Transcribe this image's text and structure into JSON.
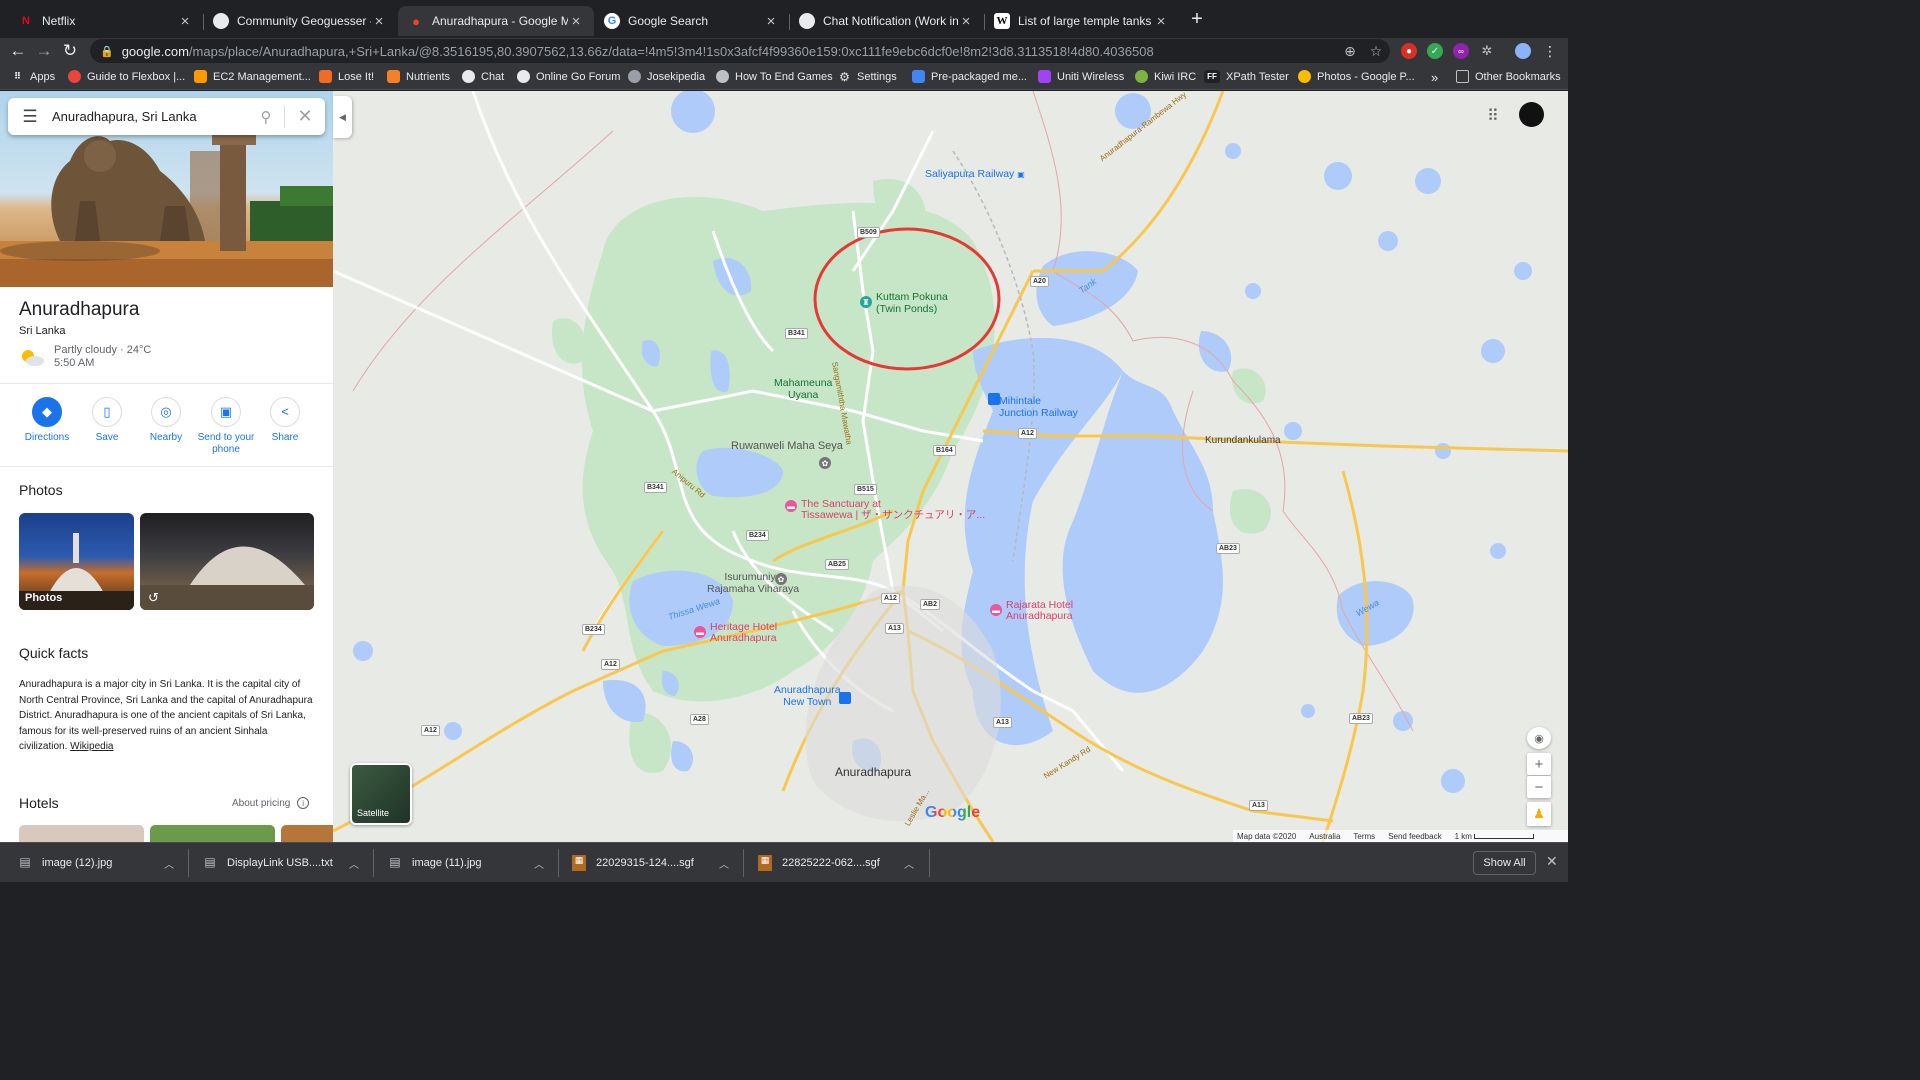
{
  "tabs": [
    {
      "title": "Netflix",
      "favicon": "netflix-icon",
      "active": false
    },
    {
      "title": "Community Geoguesser - Gen",
      "favicon": "disk-icon",
      "active": false
    },
    {
      "title": "Anuradhapura - Google Maps",
      "favicon": "maps-pin-icon",
      "active": true
    },
    {
      "title": "Google Search",
      "favicon": "google-icon",
      "active": false
    },
    {
      "title": "Chat Notification (Work in prog",
      "favicon": "disk-icon",
      "active": false
    },
    {
      "title": "List of large temple tanks - Wik",
      "favicon": "wikipedia-icon",
      "active": false
    }
  ],
  "address": {
    "host": "google.com",
    "path": "/maps/place/Anuradhapura,+Sri+Lanka/@8.3516195,80.3907562,13.66z/data=!4m5!3m4!1s0x3afcf4f99360e159:0xc111fe9ebc6dcf0e!8m2!3d8.3113518!4d80.4036508"
  },
  "bookmarks": [
    {
      "label": "Apps",
      "icon": "apps-grid-icon",
      "color": "#5f6368"
    },
    {
      "label": "Guide to Flexbox |...",
      "icon": "flexbox-icon",
      "color": "#e8453c"
    },
    {
      "label": "EC2 Management...",
      "icon": "aws-icon",
      "color": "#ff9900"
    },
    {
      "label": "Lose It!",
      "icon": "loseit-icon",
      "color": "#f26b21"
    },
    {
      "label": "Nutrients",
      "icon": "nutrients-icon",
      "color": "#f58025"
    },
    {
      "label": "Chat",
      "icon": "disk-icon",
      "color": "#c4c7c5"
    },
    {
      "label": "Online Go Forum",
      "icon": "disk-icon",
      "color": "#c4c7c5"
    },
    {
      "label": "Josekipedia",
      "icon": "globe-icon",
      "color": "#9aa0a6"
    },
    {
      "label": "How To End Games",
      "icon": "github-icon",
      "color": "#9aa0a6"
    },
    {
      "label": "Settings",
      "icon": "gear-icon",
      "color": "#9aa0a6"
    },
    {
      "label": "Pre-packaged me...",
      "icon": "docs-icon",
      "color": "#4285f4"
    },
    {
      "label": "Uniti Wireless",
      "icon": "uniti-icon",
      "color": "#a142f4"
    },
    {
      "label": "Kiwi IRC",
      "icon": "kiwi-icon",
      "color": "#7cb342"
    },
    {
      "label": "XPath Tester",
      "icon": "ff-icon",
      "color": "#202124"
    },
    {
      "label": "Photos - Google P...",
      "icon": "photos-icon",
      "color": "#fbbc04"
    }
  ],
  "bookmarks_more": "»",
  "other_bookmarks": "Other Bookmarks",
  "search": {
    "query": "Anuradhapura, Sri Lanka"
  },
  "place": {
    "title": "Anuradhapura",
    "subtitle": "Sri Lanka",
    "weather": "Partly cloudy · 24°C",
    "time": "5:50 AM"
  },
  "actions": [
    {
      "label": "Directions",
      "icon": "directions-icon"
    },
    {
      "label": "Save",
      "icon": "bookmark-icon"
    },
    {
      "label": "Nearby",
      "icon": "nearby-icon"
    },
    {
      "label": "Send to your phone",
      "icon": "send-to-phone-icon"
    },
    {
      "label": "Share",
      "icon": "share-icon"
    }
  ],
  "photos": {
    "heading": "Photos",
    "tile_label": "Photos"
  },
  "quick_facts": {
    "heading": "Quick facts",
    "text": "Anuradhapura is a major city in Sri Lanka. It is the capital city of North Central Province, Sri Lanka and the capital of Anuradhapura District. Anuradhapura is one of the ancient capitals of Sri Lanka, famous for its well-preserved ruins of an ancient Sinhala civilization.",
    "link": "Wikipedia"
  },
  "hotels": {
    "heading": "Hotels",
    "about_pricing": "About pricing"
  },
  "map": {
    "labels": {
      "saliyapura": "Saliyapura Railway",
      "rambewa_hwy": "Anuradhapura-Rambewa Hwy",
      "kuttam_1": "Kuttam Pokuna",
      "kuttam_2": "(Twin Ponds)",
      "mahameuna_1": "Mahameuna",
      "mahameuna_2": "Uyana",
      "mihintale_1": "Mihintale",
      "mihintale_2": "Junction Railway",
      "kurundankulama": "Kurundankulama",
      "ruwanweli": "Ruwanweli Maha Seya",
      "sanctuary_1": "The Sanctuary at",
      "sanctuary_2": "Tissawewa | ザ・サンクチュアリ・ア...",
      "isurumuniya_1": "Isurumuniya",
      "isurumuniya_2": "Rajamaha Viharaya",
      "heritage_1": "Heritage Hotel",
      "heritage_2": "Anuradhapura",
      "rajarata_1": "Rajarata Hotel",
      "rajarata_2": "Anuradhapura",
      "newtown_1": "Anuradhapura",
      "newtown_2": "New Town",
      "city": "Anuradhapura",
      "tank": "Tank",
      "wewa": "Wewa",
      "thissa": "Thissa Wewa",
      "sangamiththa": "Sangamiththa Mawatha",
      "anipuru": "Anipuru Rd",
      "newkandy": "New Kandy Rd",
      "lesliema": "Leslie Ma..."
    },
    "shields": {
      "b509": "B509",
      "b341a": "B341",
      "a20": "A20",
      "a12a": "A12",
      "b164": "B164",
      "b341b": "B341",
      "b515": "B515",
      "b234a": "B234",
      "ab25": "AB25",
      "ab23a": "AB23",
      "a12b": "A12",
      "ab2": "AB2",
      "a13a": "A13",
      "b234b": "B234",
      "a12c": "A12",
      "a28": "A28",
      "a13b": "A13",
      "ab23b": "AB23",
      "a12d": "A12",
      "a13c": "A13"
    },
    "satellite": "Satellite",
    "google": "Google",
    "footer": [
      "Map data ©2020",
      "Australia",
      "Terms",
      "Send feedback",
      "1 km"
    ]
  },
  "downloads": [
    {
      "name": "image (12).jpg",
      "icon": "file-icon"
    },
    {
      "name": "DisplayLink USB....txt",
      "icon": "file-icon"
    },
    {
      "name": "image (11).jpg",
      "icon": "file-icon"
    },
    {
      "name": "22029315-124....sgf",
      "icon": "sgf-file-icon"
    },
    {
      "name": "22825222-062....sgf",
      "icon": "sgf-file-icon"
    }
  ],
  "show_all": "Show All",
  "colors": {
    "map_water": "#aecbfa",
    "map_park": "#c4e7c6",
    "map_land": "#e8eae6",
    "highway": "#f8c74f",
    "annotation": "#e53935",
    "accent": "#1a73e8"
  }
}
